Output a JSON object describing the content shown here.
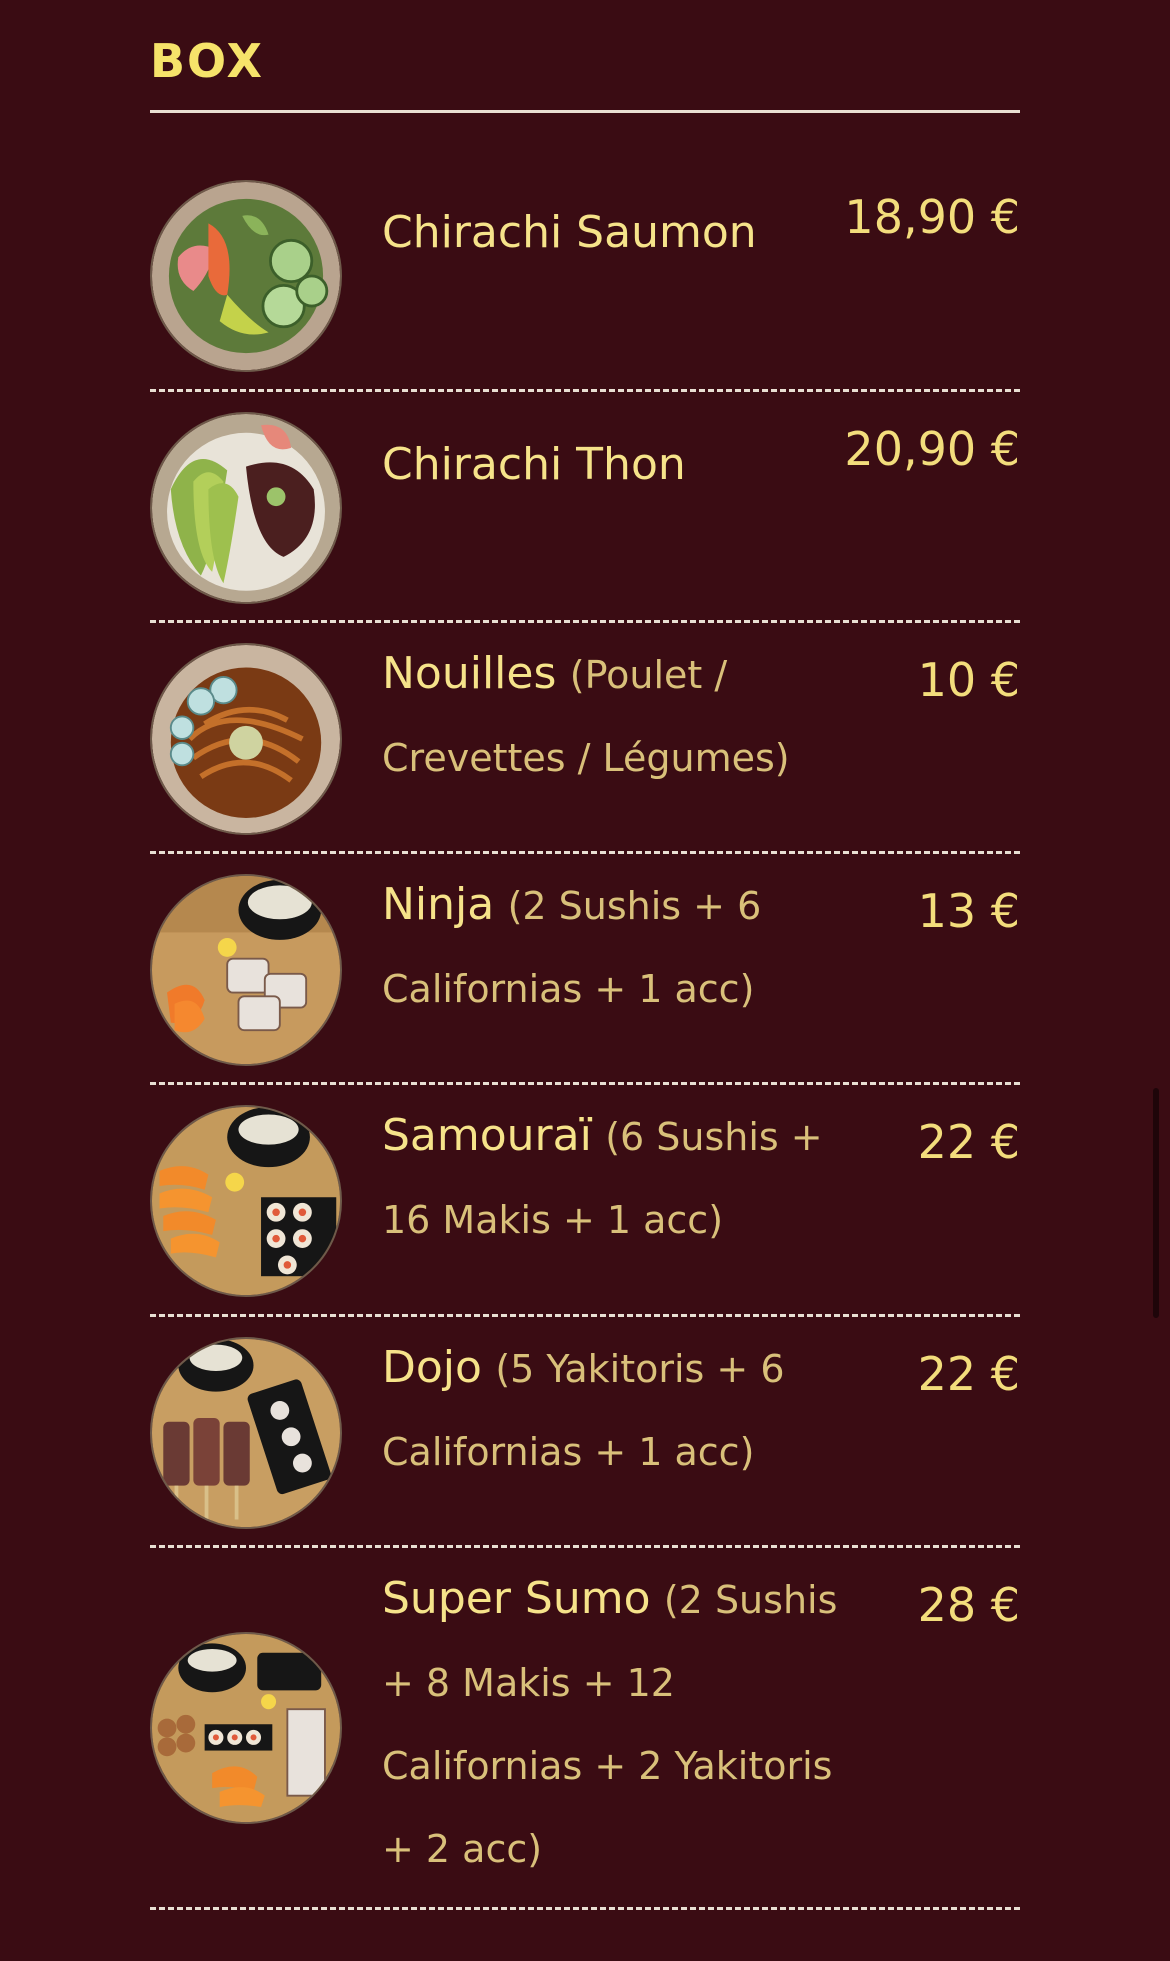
{
  "section": {
    "title": "BOX"
  },
  "items": [
    {
      "name": "Chirachi Saumon",
      "detail": "",
      "price": "18,90 €",
      "photo": "salmon-chirashi-bowl-photo"
    },
    {
      "name": "Chirachi Thon",
      "detail": "",
      "price": "20,90 €",
      "photo": "tuna-chirashi-bowl-photo"
    },
    {
      "name": "Nouilles",
      "detail": "(Poulet / Crevettes / Légumes)",
      "price": "10 €",
      "photo": "noodles-bowl-photo"
    },
    {
      "name": "Ninja",
      "detail": "(2 Sushis + 6 Californias + 1 acc)",
      "price": "13 €",
      "photo": "ninja-box-photo"
    },
    {
      "name": "Samouraï",
      "detail": "(6 Sushis + 16 Makis + 1 acc)",
      "price": "22 €",
      "photo": "samourai-box-photo"
    },
    {
      "name": "Dojo",
      "detail": "(5 Yakitoris + 6 Californias + 1 acc)",
      "price": "22 €",
      "photo": "dojo-box-photo"
    },
    {
      "name": "Super Sumo",
      "detail": "(2 Sushis + 8 Makis + 12 Californias + 2 Yakitoris + 2 acc)",
      "price": "28 €",
      "photo": "super-sumo-box-photo"
    }
  ],
  "colors": {
    "background": "#3a0c13",
    "accent": "#f6e36a",
    "text": "#f3dd7c",
    "divider": "#e9dfd2"
  }
}
